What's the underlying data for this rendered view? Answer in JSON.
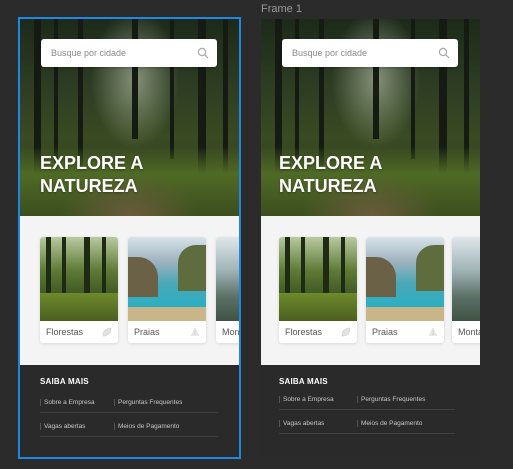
{
  "canvas": {
    "frame_label": "Frame 1"
  },
  "app": {
    "search": {
      "placeholder": "Busque por cidade",
      "icon": "search-icon"
    },
    "hero": {
      "title_line1": "EXPLORE A",
      "title_line2": "NATUREZA"
    },
    "categories": [
      {
        "label": "Florestas",
        "icon": "leaf-icon"
      },
      {
        "label": "Praias",
        "icon": "beach-icon"
      },
      {
        "label": "Montanhas",
        "icon": "mountain-icon"
      }
    ],
    "footer": {
      "title": "SAIBA MAIS",
      "links": [
        "Sobre a Empresa",
        "Perguntas Frequentes",
        "Vagas abertas",
        "Meios de Pagamento"
      ]
    }
  },
  "colors": {
    "canvas_bg": "#2b2b2b",
    "selection": "#1e88e5",
    "footer_bg": "#2a2a2a",
    "card_bg": "#ffffff"
  }
}
